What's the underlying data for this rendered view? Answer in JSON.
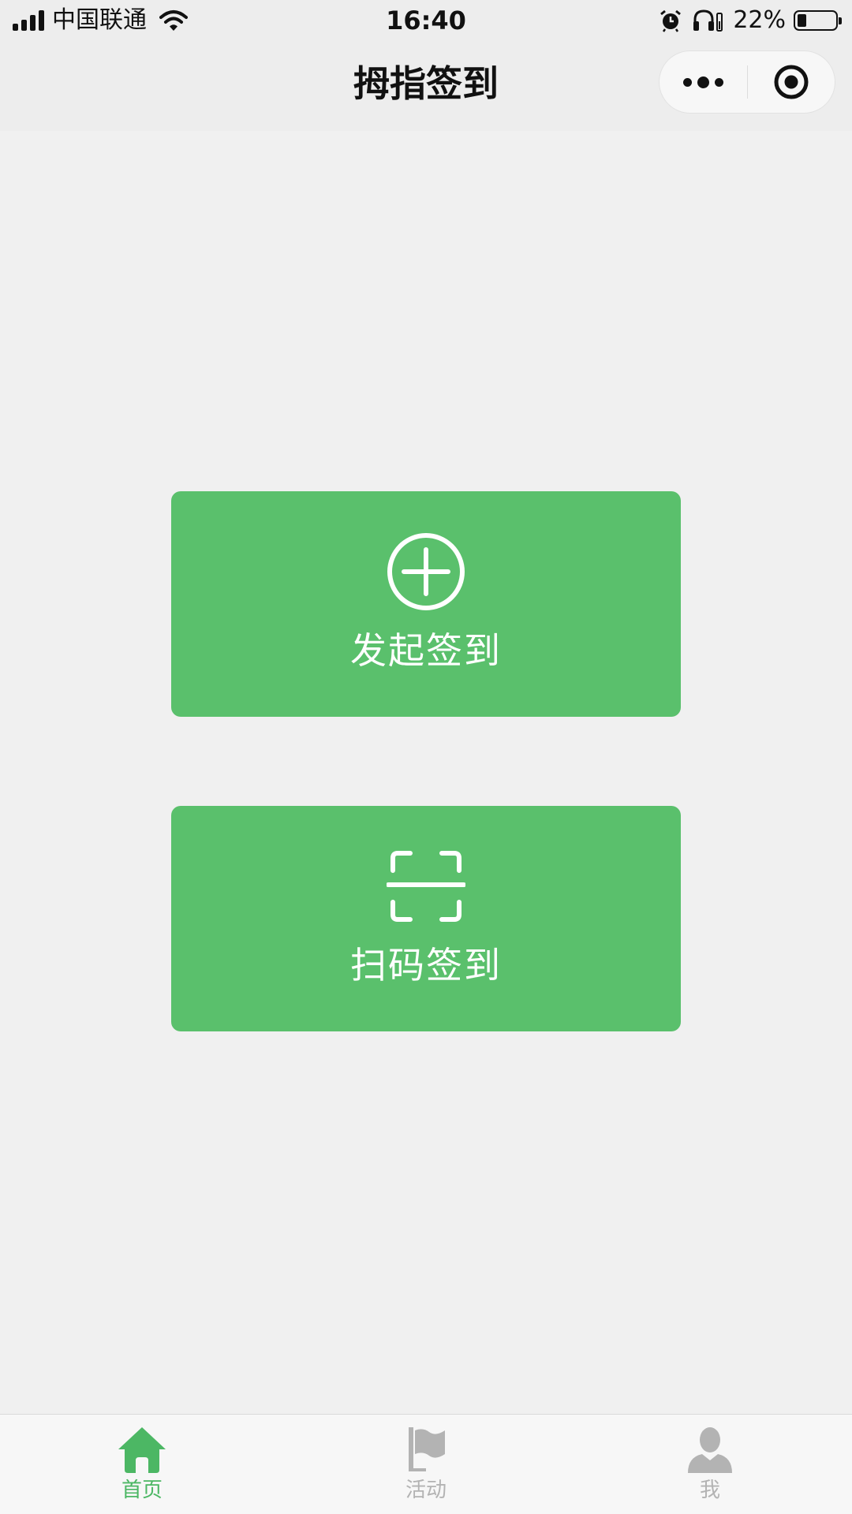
{
  "status_bar": {
    "carrier": "中国联通",
    "time": "16:40",
    "battery_percent": "22%",
    "battery_level": 0.22,
    "icons": [
      "signal-icon",
      "wifi-icon",
      "alarm-icon",
      "headphones-icon",
      "battery-icon"
    ]
  },
  "nav": {
    "title": "拇指签到",
    "capsule_icons": [
      "more-icon",
      "close-miniprogram-icon"
    ]
  },
  "actions": [
    {
      "label": "发起签到",
      "icon": "plus-circle-icon"
    },
    {
      "label": "扫码签到",
      "icon": "scan-icon"
    }
  ],
  "tabbar": {
    "items": [
      {
        "label": "首页",
        "icon": "home-icon",
        "active": true
      },
      {
        "label": "活动",
        "icon": "flag-icon",
        "active": false
      },
      {
        "label": "我",
        "icon": "person-icon",
        "active": false
      }
    ]
  },
  "colors": {
    "accent": "#5ac06c",
    "tab_active": "#4cb764",
    "tab_inactive": "#b3b3b3",
    "background": "#f0f0f0",
    "nav_background": "#ededed"
  }
}
